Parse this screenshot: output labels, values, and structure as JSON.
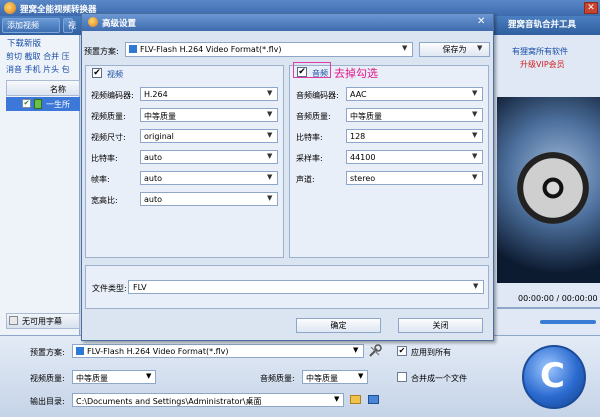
{
  "app": {
    "title": "狸窝全能视频转换器",
    "close_icon": "✕",
    "toolbar": {
      "add_video": "添加视频",
      "mid_tab": "视",
      "merge_tool": "狸窝音轨合并工具"
    },
    "left": {
      "download_label": "下载新版",
      "links_row1": "剪切 截取 合并 压",
      "links_row2": "消音 手机 片头 包",
      "list_header_name": "名称",
      "row_text": "一生所",
      "no_subtitle": "无可用字幕"
    },
    "right": {
      "promo1": "有狸窝所有软件",
      "promo2": "升级VIP会员",
      "time": "00:00:00 / 00:00:00"
    },
    "bottom": {
      "preset_label": "预置方案:",
      "preset_value": "FLV-Flash H.264 Video Format(*.flv)",
      "apply_all": "应用到所有",
      "apply_all_checked": true,
      "video_quality_label": "视频质量:",
      "video_quality_value": "中等质量",
      "audio_quality_label": "音频质量:",
      "audio_quality_value": "中等质量",
      "merge_one": "合并成一个文件",
      "merge_one_checked": false,
      "output_label": "输出目录:",
      "output_value": "C:\\Documents and Settings\\Administrator\\桌面"
    }
  },
  "dialog": {
    "title": "高级设置",
    "close_icon": "✕",
    "preset_label": "预置方案:",
    "preset_value": "FLV-Flash H.264 Video Format(*.flv)",
    "save_as": "保存为",
    "video": {
      "label": "视频",
      "checked": true,
      "fields": [
        {
          "label": "视频编码器:",
          "value": "H.264"
        },
        {
          "label": "视频质量:",
          "value": "中等质量"
        },
        {
          "label": "视频尺寸:",
          "value": "original"
        },
        {
          "label": "比特率:",
          "value": "auto"
        },
        {
          "label": "帧率:",
          "value": "auto"
        },
        {
          "label": "宽高比:",
          "value": "auto"
        }
      ]
    },
    "audio": {
      "label": "音频",
      "checked": true,
      "annotation": "去掉勾选",
      "highlight_color": "#e23aa4",
      "fields": [
        {
          "label": "音频编码器:",
          "value": "AAC"
        },
        {
          "label": "音频质量:",
          "value": "中等质量"
        },
        {
          "label": "比特率:",
          "value": "128"
        },
        {
          "label": "采样率:",
          "value": "44100"
        },
        {
          "label": "声道:",
          "value": "stereo"
        }
      ]
    },
    "file_type_label": "文件类型:",
    "file_type_value": "FLV",
    "ok": "确定",
    "close": "关闭"
  },
  "icons": {
    "checkmark": "✔",
    "dropdown_arrow": "▼",
    "convert": "C"
  }
}
